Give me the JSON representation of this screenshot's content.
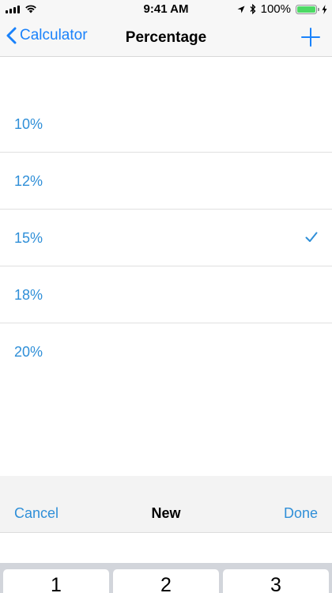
{
  "status_bar": {
    "time": "9:41 AM",
    "battery_percent_label": "100%",
    "battery_level": 1.0,
    "icons": [
      "signal-icon",
      "wifi-icon",
      "location-arrow-icon",
      "bluetooth-icon",
      "battery-icon",
      "charging-bolt-icon"
    ]
  },
  "nav": {
    "back_label": "Calculator",
    "title": "Percentage",
    "add_icon": "plus-icon"
  },
  "list": {
    "items": [
      {
        "label": "10%",
        "selected": false
      },
      {
        "label": "12%",
        "selected": false
      },
      {
        "label": "15%",
        "selected": true
      },
      {
        "label": "18%",
        "selected": false
      },
      {
        "label": "20%",
        "selected": false
      }
    ]
  },
  "toolbar": {
    "cancel_label": "Cancel",
    "title": "New",
    "done_label": "Done"
  },
  "keyboard": {
    "keys": [
      "1",
      "2",
      "3"
    ]
  },
  "colors": {
    "accent": "#1a82fb",
    "list_text": "#2f8fd8",
    "battery_green": "#4cd964"
  }
}
